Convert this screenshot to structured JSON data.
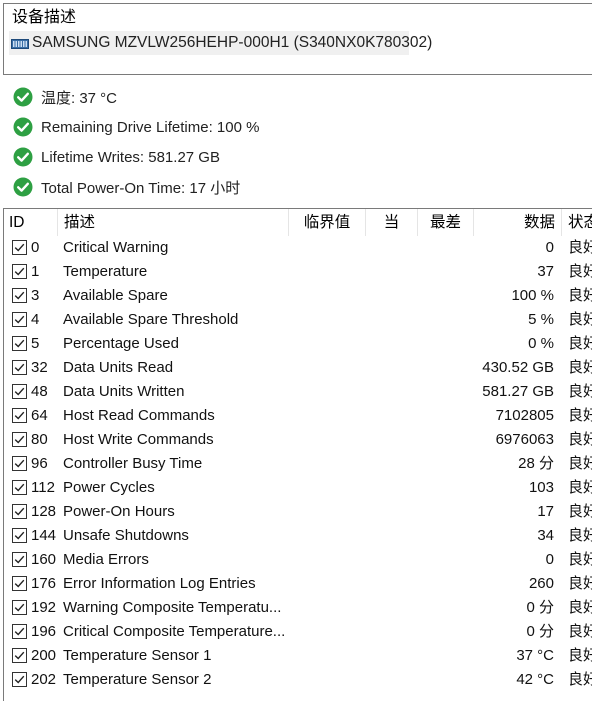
{
  "desc_title": "设备描述",
  "device_name": "SAMSUNG MZVLW256HEHP-000H1 (S340NX0K780302)",
  "status_items": [
    "温度: 37 °C",
    "Remaining Drive Lifetime: 100 %",
    "Lifetime Writes: 581.27 GB",
    "Total Power-On Time: 17 小时"
  ],
  "columns": {
    "id": "ID",
    "desc": "描述",
    "threshold": "临界值",
    "current": "当",
    "worst": "最差",
    "data": "数据",
    "status": "状态"
  },
  "rows": [
    {
      "id": "0",
      "desc": "Critical Warning",
      "data": "0",
      "status": "良好"
    },
    {
      "id": "1",
      "desc": "Temperature",
      "data": "37",
      "status": "良好"
    },
    {
      "id": "3",
      "desc": "Available Spare",
      "data": "100 %",
      "status": "良好"
    },
    {
      "id": "4",
      "desc": "Available Spare Threshold",
      "data": "5 %",
      "status": "良好"
    },
    {
      "id": "5",
      "desc": "Percentage Used",
      "data": "0 %",
      "status": "良好"
    },
    {
      "id": "32",
      "desc": "Data Units Read",
      "data": "430.52 GB",
      "status": "良好"
    },
    {
      "id": "48",
      "desc": "Data Units Written",
      "data": "581.27 GB",
      "status": "良好"
    },
    {
      "id": "64",
      "desc": "Host Read Commands",
      "data": "7102805",
      "status": "良好"
    },
    {
      "id": "80",
      "desc": "Host Write Commands",
      "data": "6976063",
      "status": "良好"
    },
    {
      "id": "96",
      "desc": "Controller Busy Time",
      "data": "28 分",
      "status": "良好"
    },
    {
      "id": "112",
      "desc": "Power Cycles",
      "data": "103",
      "status": "良好"
    },
    {
      "id": "128",
      "desc": "Power-On Hours",
      "data": "17",
      "status": "良好"
    },
    {
      "id": "144",
      "desc": "Unsafe Shutdowns",
      "data": "34",
      "status": "良好"
    },
    {
      "id": "160",
      "desc": "Media Errors",
      "data": "0",
      "status": "良好"
    },
    {
      "id": "176",
      "desc": "Error Information Log Entries",
      "data": "260",
      "status": "良好"
    },
    {
      "id": "192",
      "desc": "Warning Composite Temperatu...",
      "data": "0 分",
      "status": "良好"
    },
    {
      "id": "196",
      "desc": "Critical Composite Temperature...",
      "data": "0 分",
      "status": "良好"
    },
    {
      "id": "200",
      "desc": "Temperature Sensor 1",
      "data": "37 °C",
      "status": "良好"
    },
    {
      "id": "202",
      "desc": "Temperature Sensor 2",
      "data": "42 °C",
      "status": "良好"
    }
  ],
  "colors": {
    "ok_green": "#2ea043",
    "drive_blue": "#3a6ea5"
  },
  "icons": {
    "status": "check-circle-icon",
    "drive": "drive-icon",
    "row_check": "checkbox-checked-icon"
  }
}
